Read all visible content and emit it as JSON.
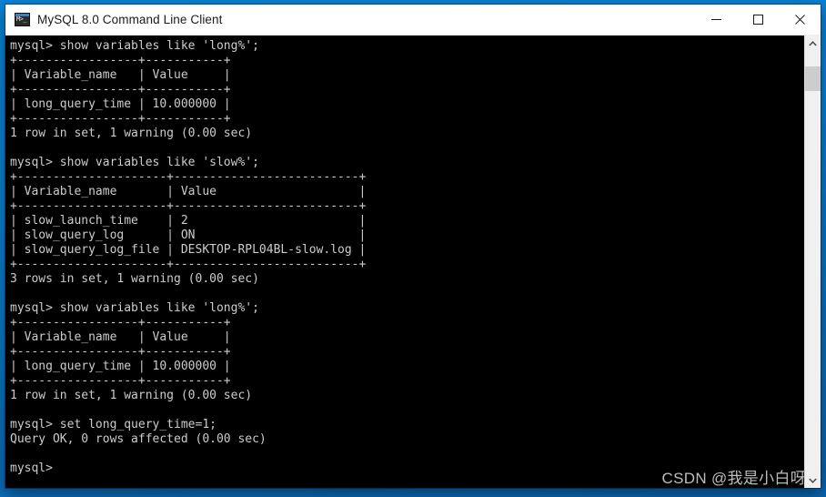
{
  "window": {
    "title": "MySQL 8.0 Command Line Client",
    "icon": "mysql-console-icon",
    "controls": {
      "minimize": "—",
      "maximize": "□",
      "close": "✕"
    }
  },
  "colors": {
    "desktop_blue": "#0a7fd0",
    "titlebar_bg": "#ffffff",
    "terminal_bg": "#000000",
    "terminal_fg": "#cccccc",
    "scrollbar_track": "#f0f0f0",
    "scrollbar_thumb": "#cdcdcd",
    "watermark_fg": "#bdbdbd"
  },
  "scrollbar": {
    "up_arrow": "▲",
    "down_arrow": "▼",
    "thumb_position_pct": 4
  },
  "watermark": {
    "text": "CSDN @我是小白呀"
  },
  "terminal": {
    "prompt": "mysql>",
    "lines": [
      "mysql> show variables like 'long%';",
      "+-----------------+-----------+",
      "| Variable_name   | Value     |",
      "+-----------------+-----------+",
      "| long_query_time | 10.000000 |",
      "+-----------------+-----------+",
      "1 row in set, 1 warning (0.00 sec)",
      "",
      "mysql> show variables like 'slow%';",
      "+---------------------+--------------------------+",
      "| Variable_name       | Value                    |",
      "+---------------------+--------------------------+",
      "| slow_launch_time    | 2                        |",
      "| slow_query_log      | ON                       |",
      "| slow_query_log_file | DESKTOP-RPL04BL-slow.log |",
      "+---------------------+--------------------------+",
      "3 rows in set, 1 warning (0.00 sec)",
      "",
      "mysql> show variables like 'long%';",
      "+-----------------+-----------+",
      "| Variable_name   | Value     |",
      "+-----------------+-----------+",
      "| long_query_time | 10.000000 |",
      "+-----------------+-----------+",
      "1 row in set, 1 warning (0.00 sec)",
      "",
      "mysql> set long_query_time=1;",
      "Query OK, 0 rows affected (0.00 sec)",
      "",
      "mysql>"
    ]
  }
}
